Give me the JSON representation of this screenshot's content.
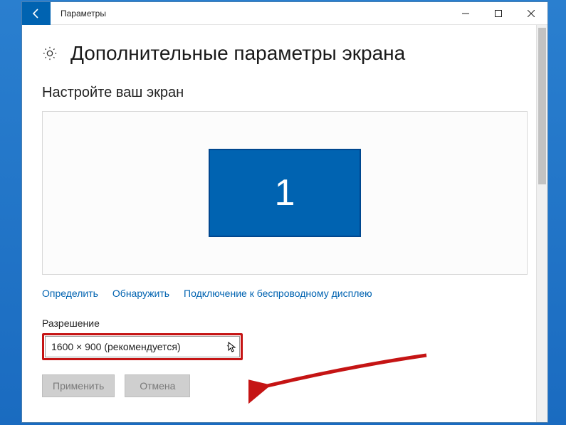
{
  "titlebar": {
    "title": "Параметры"
  },
  "page": {
    "heading": "Дополнительные параметры экрана",
    "section_title": "Настройте ваш экран",
    "monitor_number": "1"
  },
  "links": {
    "identify": "Определить",
    "detect": "Обнаружить",
    "wireless": "Подключение к беспроводному дисплею"
  },
  "resolution": {
    "label": "Разрешение",
    "value": "1600 × 900 (рекомендуется)"
  },
  "buttons": {
    "apply": "Применить",
    "cancel": "Отмена"
  }
}
